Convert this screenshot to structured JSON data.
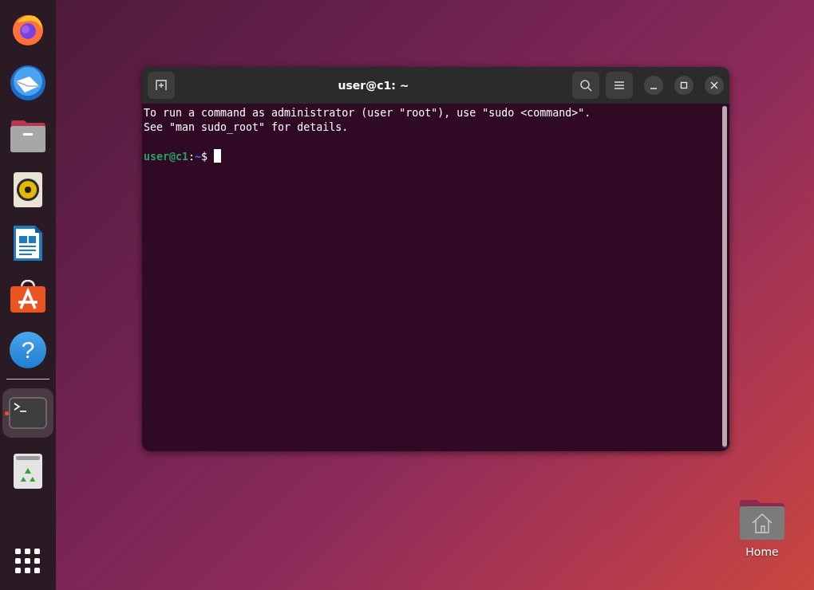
{
  "dock": {
    "items": [
      {
        "kind": "firefox",
        "running": false
      },
      {
        "kind": "thunderbird",
        "running": false
      },
      {
        "kind": "files",
        "running": false
      },
      {
        "kind": "rhythmbox",
        "running": false
      },
      {
        "kind": "writer",
        "running": false
      },
      {
        "kind": "software",
        "running": false
      },
      {
        "kind": "help",
        "running": false,
        "glyph": "?"
      },
      {
        "kind": "separator"
      },
      {
        "kind": "terminal",
        "running": true
      },
      {
        "kind": "trash",
        "running": false
      },
      {
        "kind": "apps"
      }
    ]
  },
  "window": {
    "title": "user@c1: ~",
    "focused": true
  },
  "terminal": {
    "lines": [
      "To run a command as administrator (user \"root\"), use \"sudo <command>\".",
      "See \"man sudo_root\" for details."
    ],
    "prompt": {
      "user_host": "user@c1",
      "separator": ":",
      "path": "~",
      "symbol": "$"
    },
    "cursor": true
  },
  "desktop": {
    "icons": [
      {
        "label": "Home",
        "kind": "home-folder"
      }
    ]
  }
}
